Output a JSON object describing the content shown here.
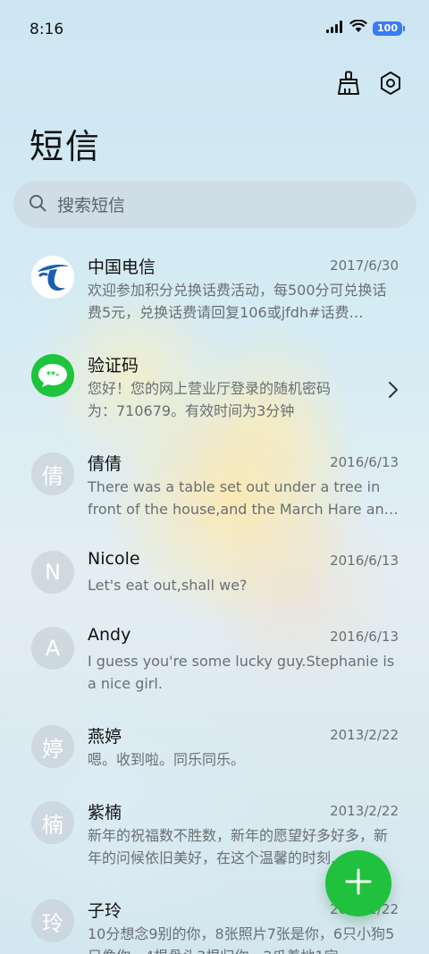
{
  "status_bar": {
    "time": "8:16",
    "battery": "100"
  },
  "header": {
    "title": "短信"
  },
  "search": {
    "placeholder": "搜索短信"
  },
  "conversations": [
    {
      "name": "中国电信",
      "date": "2017/6/30",
      "preview": "欢迎参加积分兑换话费活动，每500分可兑换话费5元，兑换话费请回复106或jfdh#话费…",
      "avatar_icon": "china-telecom-logo"
    },
    {
      "name": "验证码",
      "date": "",
      "preview": "您好！您的网上营业厅登录的随机密码为：710679。有效时间为3分钟",
      "avatar_icon": "sms-bubble-icon"
    },
    {
      "name": "倩倩",
      "date": "2016/6/13",
      "preview": "There was a table set out under a tree in front of the house,and the March Hare an…",
      "avatar_letter": "倩"
    },
    {
      "name": "Nicole",
      "date": "2016/6/13",
      "preview": "Let's eat out,shall we?",
      "avatar_letter": "N"
    },
    {
      "name": "Andy",
      "date": "2016/6/13",
      "preview": "I guess you're some lucky guy.Stephanie is a nice girl.",
      "avatar_letter": "A"
    },
    {
      "name": "燕婷",
      "date": "2013/2/22",
      "preview": "嗯。收到啦。同乐同乐。",
      "avatar_letter": "婷"
    },
    {
      "name": "紫楠",
      "date": "2013/2/22",
      "preview": "新年的祝福数不胜数，新年的愿望好多好多，新年的问候依旧美好，在这个温馨的时刻…",
      "avatar_letter": "楠"
    },
    {
      "name": "子玲",
      "date": "2013/2/22",
      "preview": "10分想念9别的你，8张照片7张是你，6只小狗5只像你，4根骨头3根归你，2爪着地1定…",
      "avatar_letter": "玲"
    }
  ],
  "colors": {
    "accent_green": "#20c13c",
    "battery_blue": "#3a7bf6"
  }
}
